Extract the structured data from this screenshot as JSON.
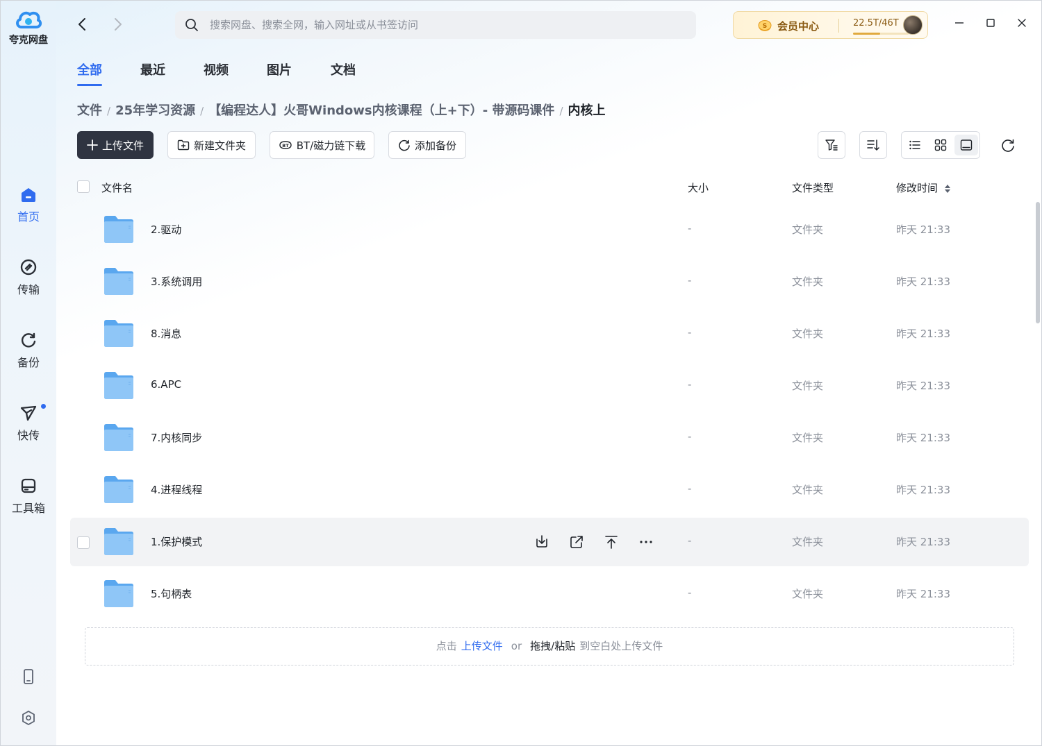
{
  "app": {
    "name": "夸克网盘",
    "brand_color": "#2f6bef"
  },
  "sidebar": {
    "items": [
      {
        "label": "首页",
        "icon": "home-icon",
        "active": true
      },
      {
        "label": "传输",
        "icon": "transfer-icon"
      },
      {
        "label": "备份",
        "icon": "backup-icon"
      },
      {
        "label": "快传",
        "icon": "send-icon",
        "badge_dot": true
      },
      {
        "label": "工具箱",
        "icon": "toolbox-icon"
      }
    ],
    "bottom": [
      "phone-icon",
      "settings-icon"
    ]
  },
  "search": {
    "placeholder": "搜索网盘、搜索全网，输入网址或从书签访问"
  },
  "vip": {
    "label": "会员中心",
    "storage": "22.5T/46T",
    "storage_used_fraction": 0.49
  },
  "tabs": [
    {
      "label": "全部",
      "active": true
    },
    {
      "label": "最近"
    },
    {
      "label": "视频"
    },
    {
      "label": "图片"
    },
    {
      "label": "文档"
    }
  ],
  "breadcrumb": [
    "文件",
    "25年学习资源",
    "【编程达人】火哥Windows内核课程（上+下）- 带源码课件",
    "内核上"
  ],
  "toolbar": {
    "upload": "上传文件",
    "new_folder": "新建文件夹",
    "bt_download": "BT/磁力链下载",
    "add_backup": "添加备份"
  },
  "table": {
    "headers": {
      "name": "文件名",
      "size": "大小",
      "type": "文件类型",
      "modified": "修改时间"
    },
    "rows": [
      {
        "name": "2.驱动",
        "size": "-",
        "type": "文件夹",
        "modified": "昨天 21:33"
      },
      {
        "name": "3.系统调用",
        "size": "-",
        "type": "文件夹",
        "modified": "昨天 21:33"
      },
      {
        "name": "8.消息",
        "size": "-",
        "type": "文件夹",
        "modified": "昨天 21:33"
      },
      {
        "name": "6.APC",
        "size": "-",
        "type": "文件夹",
        "modified": "昨天 21:33"
      },
      {
        "name": "7.内核同步",
        "size": "-",
        "type": "文件夹",
        "modified": "昨天 21:33"
      },
      {
        "name": "4.进程线程",
        "size": "-",
        "type": "文件夹",
        "modified": "昨天 21:33"
      },
      {
        "name": "1.保护模式",
        "size": "-",
        "type": "文件夹",
        "modified": "昨天 21:33",
        "hover": true
      },
      {
        "name": "5.句柄表",
        "size": "-",
        "type": "文件夹",
        "modified": "昨天 21:33"
      }
    ]
  },
  "dropzone": {
    "prefix": "点击",
    "link": "上传文件",
    "or": "or",
    "bold": "拖拽/粘贴",
    "suffix": "到空白处上传文件"
  }
}
